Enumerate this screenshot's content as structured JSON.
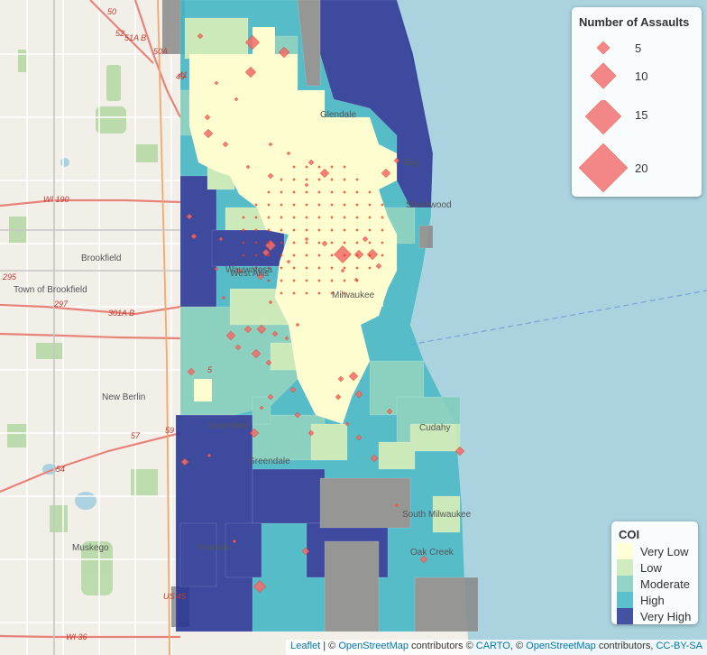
{
  "map": {
    "place_labels": [
      "Brookfield",
      "Town of Brookfield",
      "New Berlin",
      "Muskego",
      "Bay",
      "Milwaukee",
      "Franklin",
      "Greenfield",
      "Greendale",
      "Cudahy",
      "South Milwaukee",
      "Oak Creek",
      "Glendale",
      "Shorewood",
      "Wauwatosa",
      "West Allis"
    ],
    "highway_labels": [
      "WI 190",
      "295",
      "297",
      "301A B",
      "59",
      "57",
      "54",
      "5",
      "41",
      "US 45",
      "WI 36",
      "52",
      "50",
      "51A B",
      "50A",
      "49"
    ],
    "colors": {
      "very_low": "#ffffcc",
      "low": "#c7e9b4",
      "moderate": "#7fcdbb",
      "high": "#41b6c4",
      "very_high": "#253494",
      "nodata": "#8a8a8a",
      "assault": "#f03b20",
      "water": "#aad3df",
      "land": "#f2efe9"
    }
  },
  "legend_assaults": {
    "title": "Number of Assaults",
    "items": [
      {
        "label": "5",
        "value": 5
      },
      {
        "label": "10",
        "value": 10
      },
      {
        "label": "15",
        "value": 15
      },
      {
        "label": "20",
        "value": 20
      }
    ]
  },
  "legend_coi": {
    "title": "COI",
    "items": [
      {
        "label": "Very Low",
        "color": "#ffffcc"
      },
      {
        "label": "Low",
        "color": "#c7e9b4"
      },
      {
        "label": "Moderate",
        "color": "#7fcdbb"
      },
      {
        "label": "High",
        "color": "#41b6c4"
      },
      {
        "label": "Very High",
        "color": "#253494"
      }
    ]
  },
  "attribution": {
    "leaflet": "Leaflet",
    "sep1": " | © ",
    "osm": "OpenStreetMap",
    "contrib1": " contributors © ",
    "carto": "CARTO",
    "sep2": ", © ",
    "osm2": "OpenStreetMap",
    "contrib2": " contributors, ",
    "license": "CC-BY-SA"
  }
}
